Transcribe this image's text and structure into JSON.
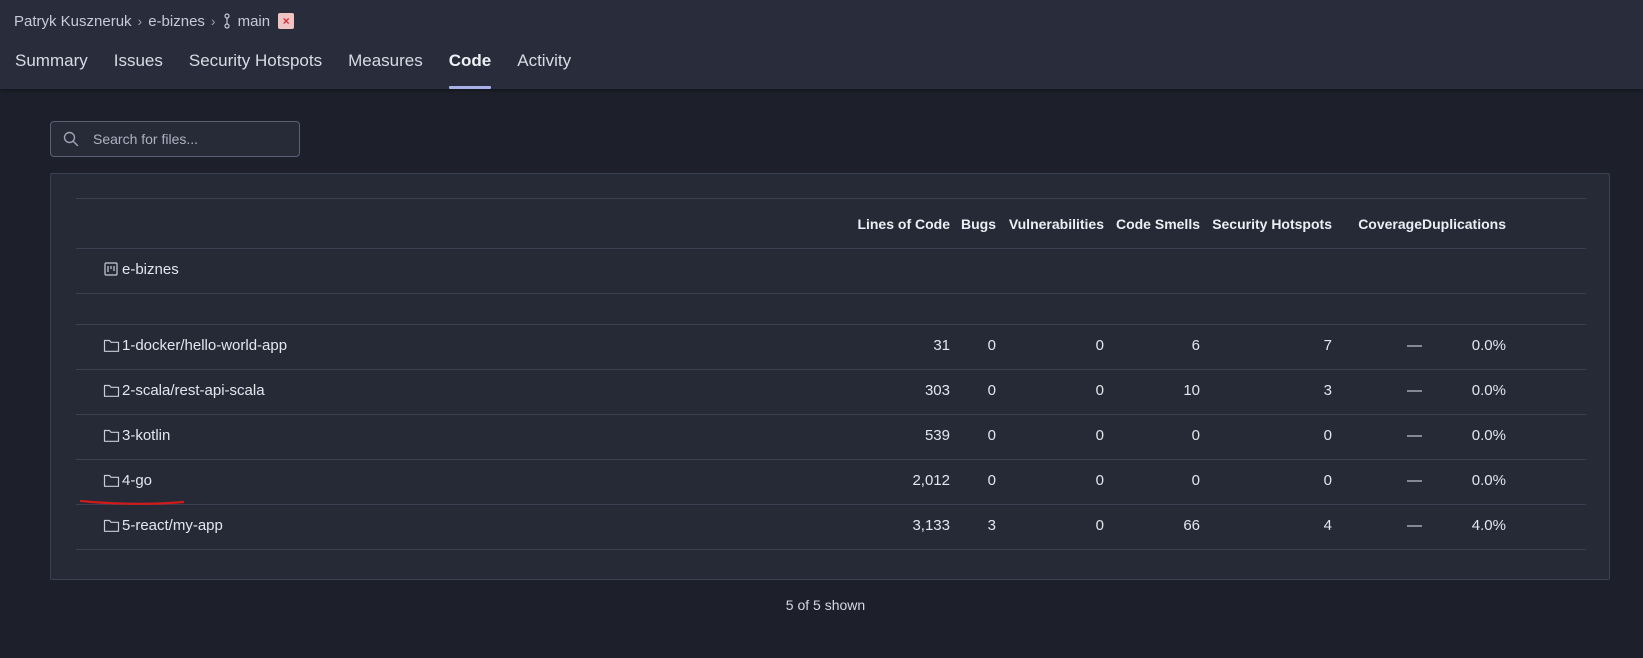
{
  "breadcrumb": {
    "owner": "Patryk Kuszneruk",
    "project": "e-biznes",
    "branch": "main",
    "branch_icon": "branch-icon",
    "badge": "×"
  },
  "tabs": [
    {
      "label": "Summary",
      "active": false
    },
    {
      "label": "Issues",
      "active": false
    },
    {
      "label": "Security Hotspots",
      "active": false
    },
    {
      "label": "Measures",
      "active": false
    },
    {
      "label": "Code",
      "active": true
    },
    {
      "label": "Activity",
      "active": false
    }
  ],
  "search": {
    "placeholder": "Search for files..."
  },
  "table": {
    "columns": [
      "Lines of Code",
      "Bugs",
      "Vulnerabilities",
      "Code Smells",
      "Security Hotspots",
      "Coverage",
      "Duplications"
    ],
    "project_row": {
      "name": "e-biznes",
      "icon": "project-icon"
    },
    "rows": [
      {
        "name": "1-docker/hello-world-app",
        "loc": "31",
        "bugs": "0",
        "vulnerabilities": "0",
        "code_smells": "6",
        "security_hotspots": "7",
        "coverage": "—",
        "duplications": "0.0%"
      },
      {
        "name": "2-scala/rest-api-scala",
        "loc": "303",
        "bugs": "0",
        "vulnerabilities": "0",
        "code_smells": "10",
        "security_hotspots": "3",
        "coverage": "—",
        "duplications": "0.0%"
      },
      {
        "name": "3-kotlin",
        "loc": "539",
        "bugs": "0",
        "vulnerabilities": "0",
        "code_smells": "0",
        "security_hotspots": "0",
        "coverage": "—",
        "duplications": "0.0%"
      },
      {
        "name": "4-go",
        "loc": "2,012",
        "bugs": "0",
        "vulnerabilities": "0",
        "code_smells": "0",
        "security_hotspots": "0",
        "coverage": "—",
        "duplications": "0.0%"
      },
      {
        "name": "5-react/my-app",
        "loc": "3,133",
        "bugs": "3",
        "vulnerabilities": "0",
        "code_smells": "66",
        "security_hotspots": "4",
        "coverage": "—",
        "duplications": "4.0%"
      }
    ]
  },
  "footer": {
    "shown": "5 of 5 shown"
  },
  "colors": {
    "accent": "#a8b0e8",
    "annotation": "#d11a1a"
  }
}
